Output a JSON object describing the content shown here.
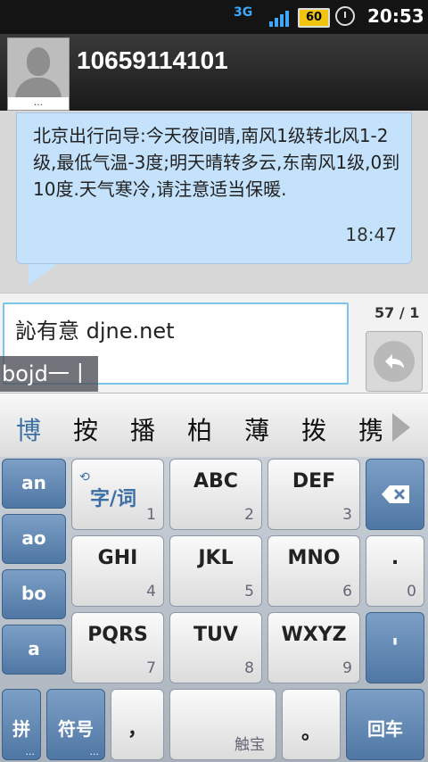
{
  "status_bar": {
    "network": "3G",
    "battery": "60",
    "time": "20:53",
    "icons": [
      "signal-icon",
      "alarm-icon",
      "battery-icon"
    ]
  },
  "header": {
    "contact": "10659114101",
    "avatar_dots": "..."
  },
  "message": {
    "text": "北京出行向导:今天夜间晴,南风1级转北风1-2级,最低气温-3度;明天晴转多云,东南风1级,0到10度.天气寒冷,请注意适当保暖.",
    "time": "18:47"
  },
  "compose": {
    "input_value": "訫有意 djne.net",
    "pinyin": "bojd一丨",
    "counter": "57 / 1"
  },
  "candidates": [
    "博",
    "按",
    "播",
    "柏",
    "薄",
    "拨",
    "携"
  ],
  "keyboard": {
    "left_column": [
      "an",
      "ao",
      "bo",
      "a"
    ],
    "rows": [
      [
        {
          "label": "字/词",
          "num": "1"
        },
        {
          "label": "ABC",
          "num": "2"
        },
        {
          "label": "DEF",
          "num": "3"
        }
      ],
      [
        {
          "label": "GHI",
          "num": "4"
        },
        {
          "label": "JKL",
          "num": "5"
        },
        {
          "label": "MNO",
          "num": "6"
        }
      ],
      [
        {
          "label": "PQRS",
          "num": "7"
        },
        {
          "label": "TUV",
          "num": "8"
        },
        {
          "label": "WXYZ",
          "num": "9"
        }
      ]
    ],
    "right_col": {
      "dot": ".",
      "zero": "0",
      "apostrophe": "'"
    },
    "bottom": {
      "pin": "拼",
      "symbol": "符号",
      "comma": "，",
      "space_brand": "触宝",
      "period": "。",
      "enter": "回车"
    }
  },
  "colors": {
    "accent": "#79c6e8",
    "bubble": "#c4e2fb",
    "keyboard_blue": "#5b82ae"
  }
}
